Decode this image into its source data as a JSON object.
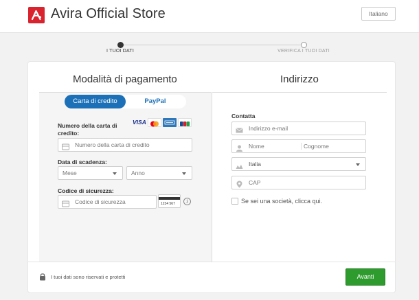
{
  "header": {
    "brand": "Avira Official Store",
    "language_button": "Italiano"
  },
  "steps": [
    {
      "label": "I TUOI DATI",
      "active": true
    },
    {
      "label": "VERIFICA I TUOI DATI",
      "active": false
    }
  ],
  "payment": {
    "title": "Modalità di pagamento",
    "tabs": [
      {
        "label": "Carta di credito",
        "selected": true
      },
      {
        "label": "PayPal",
        "selected": false
      }
    ],
    "card_logos": [
      "VISA",
      "Mastercard",
      "American Express",
      "JCB"
    ],
    "visa_text": "VISA",
    "card_number_label": "Numero della carta di credito:",
    "card_number_placeholder": "Numero della carta di credito",
    "expiry_label": "Data di scadenza:",
    "month_placeholder": "Mese",
    "year_placeholder": "Anno",
    "cvv_label": "Codice di sicurezza:",
    "cvv_placeholder": "Codice di sicurezza",
    "cvv_sample": "1234 567",
    "info_glyph": "i"
  },
  "address": {
    "title": "Indirizzo",
    "contact_label": "Contatta",
    "email_placeholder": "Indirizzo e-mail",
    "first_name_placeholder": "Nome",
    "last_name_placeholder": "Cognome",
    "country_value": "Italia",
    "zip_placeholder": "CAP",
    "company_checkbox_label": "Se sei una società, clicca qui."
  },
  "footer": {
    "secure_text": "I tuoi dati sono riservati e protetti",
    "next_button": "Avanti"
  },
  "colors": {
    "brand_red": "#d9232e",
    "primary_blue": "#1b70b8",
    "next_green": "#2d9b2d"
  }
}
